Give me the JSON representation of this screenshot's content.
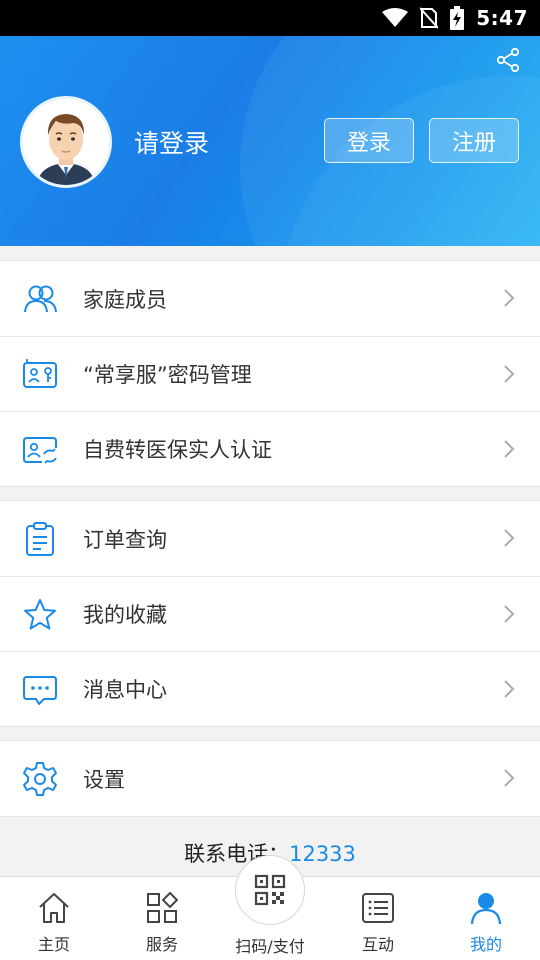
{
  "status_bar": {
    "time": "5:47"
  },
  "header": {
    "login_prompt": "请登录",
    "login_button": "登录",
    "register_button": "注册"
  },
  "menu": {
    "group1": [
      {
        "label": "家庭成员",
        "icon": "family-members-icon"
      },
      {
        "label": "“常享服”密码管理",
        "icon": "password-card-icon"
      },
      {
        "label": "自费转医保实人认证",
        "icon": "id-verify-icon"
      }
    ],
    "group2": [
      {
        "label": "订单查询",
        "icon": "clipboard-icon"
      },
      {
        "label": "我的收藏",
        "icon": "star-icon"
      },
      {
        "label": "消息中心",
        "icon": "message-icon"
      }
    ],
    "group3": [
      {
        "label": "设置",
        "icon": "gear-icon"
      }
    ]
  },
  "contact": {
    "label": "联系电话：",
    "number": "12333"
  },
  "tabbar": {
    "home": "主页",
    "services": "服务",
    "scan_pay": "扫码/支付",
    "interact": "互动",
    "mine": "我的"
  },
  "colors": {
    "accent": "#1a8ae8",
    "header_start": "#1e8ff0",
    "header_end": "#25b3f6"
  }
}
